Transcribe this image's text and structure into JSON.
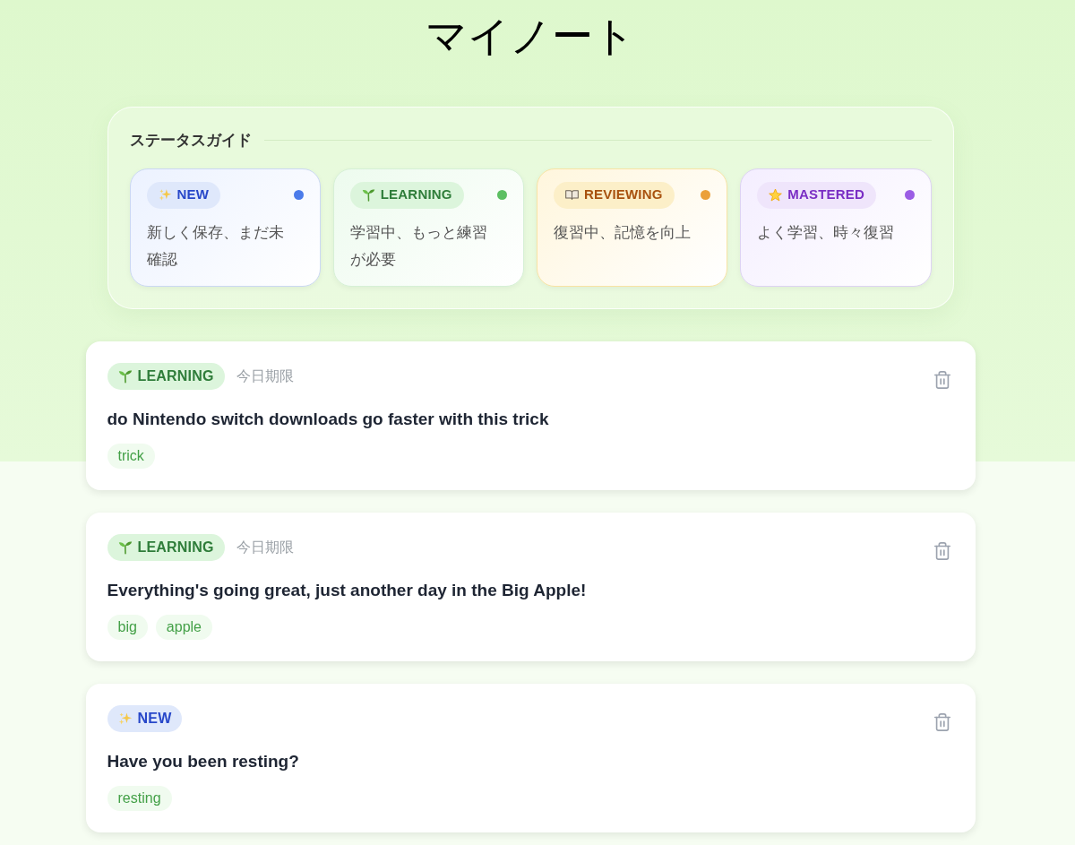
{
  "title": "マイノート",
  "status_guide": {
    "heading": "ステータスガイド",
    "items": [
      {
        "kind": "new",
        "label": "NEW",
        "color": "#4b7bea",
        "description": "新しく保存、まだ未確認"
      },
      {
        "kind": "learning",
        "label": "LEARNING",
        "color": "#5cbf62",
        "description": "学習中、もっと練習が必要"
      },
      {
        "kind": "reviewing",
        "label": "REVIEWING",
        "color": "#eba03a",
        "description": "復習中、記憶を向上"
      },
      {
        "kind": "mastered",
        "label": "MASTERED",
        "color": "#9b5de5",
        "description": "よく学習、時々復習"
      }
    ]
  },
  "notes": [
    {
      "status": {
        "kind": "learning",
        "label": "LEARNING"
      },
      "due": "今日期限",
      "text": "do Nintendo switch downloads go faster with this trick",
      "tags": [
        "trick"
      ]
    },
    {
      "status": {
        "kind": "learning",
        "label": "LEARNING"
      },
      "due": "今日期限",
      "text": "Everything's going great, just another day in the Big Apple!",
      "tags": [
        "big",
        "apple"
      ]
    },
    {
      "status": {
        "kind": "new",
        "label": "NEW"
      },
      "text": "Have you been resting?",
      "tags": [
        "resting"
      ]
    }
  ]
}
